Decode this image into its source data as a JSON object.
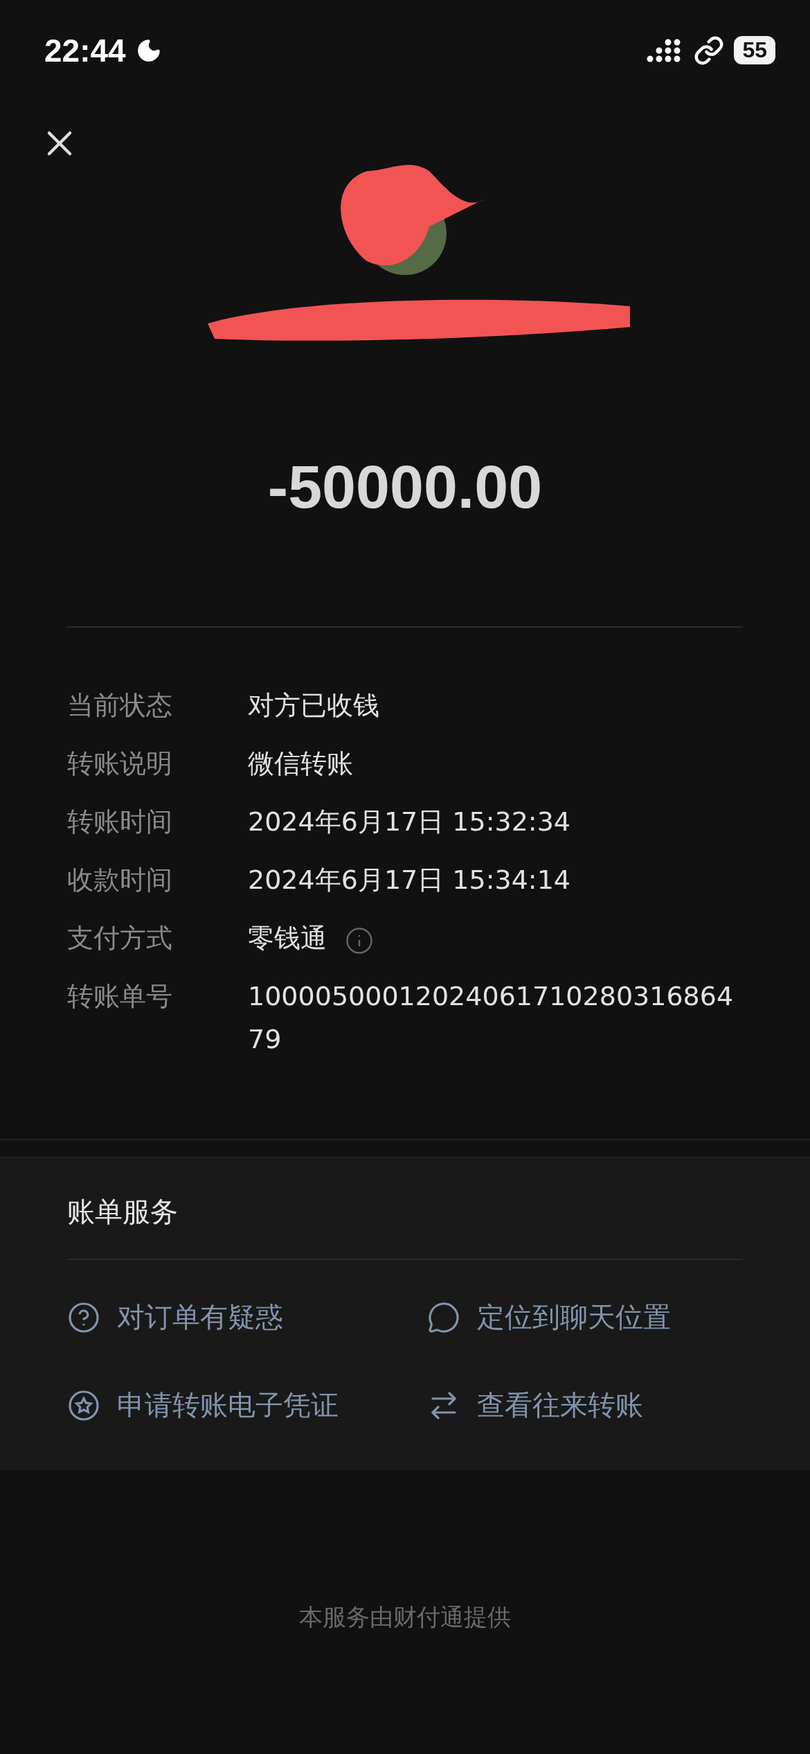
{
  "status_bar": {
    "time": "22:44",
    "battery": "55"
  },
  "amount": "-50000.00",
  "details": [
    {
      "label": "当前状态",
      "value": "对方已收钱",
      "info": false
    },
    {
      "label": "转账说明",
      "value": "微信转账",
      "info": false
    },
    {
      "label": "转账时间",
      "value": "2024年6月17日 15:32:34",
      "info": false
    },
    {
      "label": "收款时间",
      "value": "2024年6月17日 15:34:14",
      "info": false
    },
    {
      "label": "支付方式",
      "value": "零钱通",
      "info": true
    },
    {
      "label": "转账单号",
      "value": "1000050001202406171028031686479",
      "info": false
    }
  ],
  "services": {
    "title": "账单服务",
    "actions": [
      {
        "kind": "question",
        "label": "对订单有疑惑"
      },
      {
        "kind": "chat",
        "label": "定位到聊天位置"
      },
      {
        "kind": "voucher",
        "label": "申请转账电子凭证"
      },
      {
        "kind": "exchange",
        "label": "查看往来转账"
      }
    ]
  },
  "footer": "本服务由财付通提供"
}
